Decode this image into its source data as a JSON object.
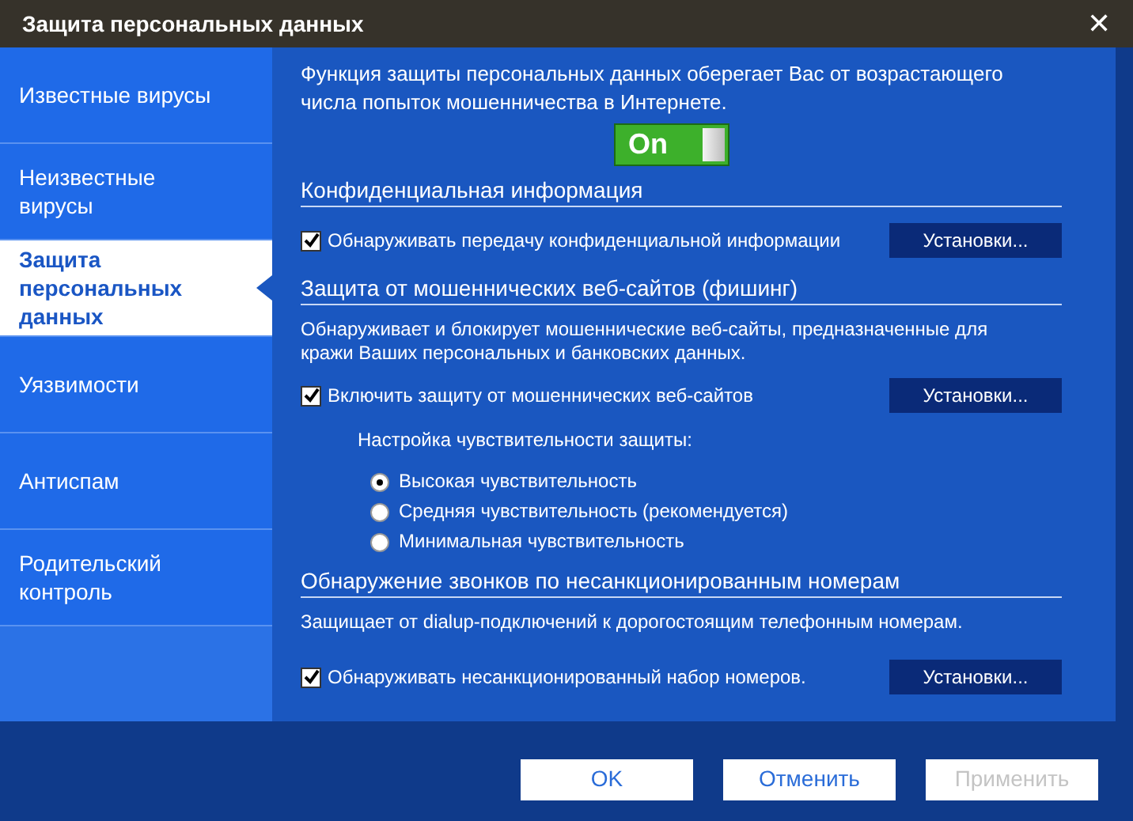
{
  "window": {
    "title": "Защита персональных данных",
    "close": "✕"
  },
  "sidebar": {
    "items": [
      {
        "label": "Известные вирусы",
        "selected": false
      },
      {
        "label": "Неизвестные вирусы",
        "selected": false
      },
      {
        "label": "Защита персональных данных",
        "selected": true
      },
      {
        "label": "Уязвимости",
        "selected": false
      },
      {
        "label": "Антиспам",
        "selected": false
      },
      {
        "label": "Родительский контроль",
        "selected": false
      }
    ]
  },
  "intro": "Функция защиты персональных данных оберегает Вас от возрастающего числа попыток мошенничества в Интернете.",
  "toggle": {
    "label": "On",
    "on": true
  },
  "sections": [
    {
      "heading": "Конфиденциальная информация",
      "option": {
        "label": "Обнаруживать передачу конфиденциальной информации",
        "checked": true,
        "button": "Установки..."
      }
    },
    {
      "heading": "Защита от мошеннических веб-сайтов (фишинг)",
      "description": "Обнаруживает и блокирует мошеннические веб-сайты, предназначенные для кражи Ваших персональных и банковских данных.",
      "option": {
        "label": "Включить защиту от мошеннических веб-сайтов",
        "checked": true,
        "button": "Установки..."
      },
      "sensitivity": {
        "label": "Настройка чувствительности защиты:",
        "options": [
          {
            "label": "Высокая чувствительность",
            "selected": true
          },
          {
            "label": "Средняя чувствительность (рекомендуется)",
            "selected": false
          },
          {
            "label": "Минимальная чувствительность",
            "selected": false
          }
        ]
      }
    },
    {
      "heading": "Обнаружение звонков по несанкционированным номерам",
      "description": "Защищает от dialup-подключений к дорогостоящим телефонным номерам.",
      "option": {
        "label": "Обнаруживать несанкционированный набор номеров.",
        "checked": true,
        "button": "Установки..."
      }
    }
  ],
  "buttons": [
    {
      "label": "OK",
      "disabled": false
    },
    {
      "label": "Отменить",
      "disabled": false
    },
    {
      "label": "Применить",
      "disabled": true
    }
  ]
}
